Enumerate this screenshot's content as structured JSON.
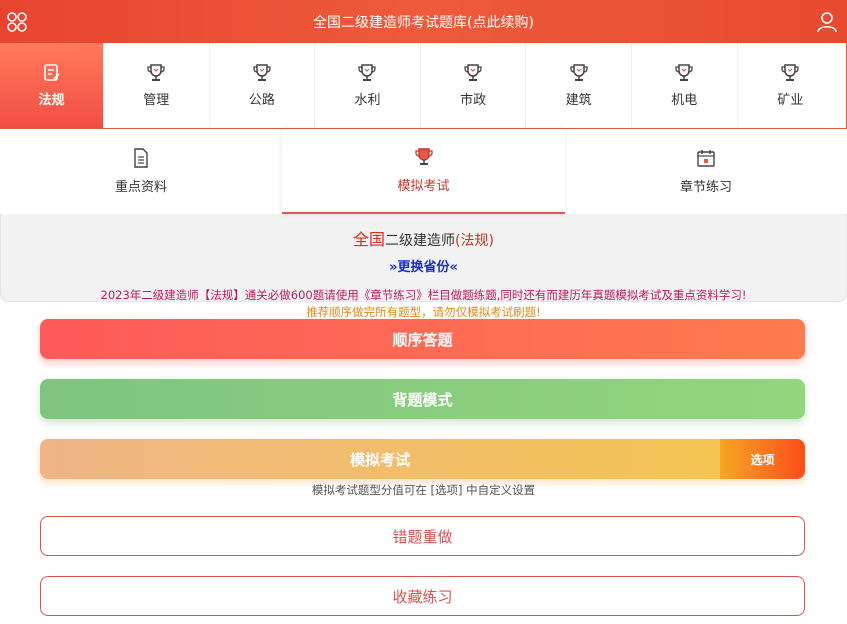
{
  "header": {
    "title": "全国二级建造师考试题库(点此续购)",
    "menu_icon": "grid-menu-icon",
    "user_icon": "user-icon"
  },
  "subjects": [
    {
      "label": "法规",
      "icon": "document-edit-icon",
      "active": true
    },
    {
      "label": "管理",
      "icon": "trophy-icon"
    },
    {
      "label": "公路",
      "icon": "trophy-icon"
    },
    {
      "label": "水利",
      "icon": "trophy-icon"
    },
    {
      "label": "市政",
      "icon": "trophy-icon"
    },
    {
      "label": "建筑",
      "icon": "trophy-icon"
    },
    {
      "label": "机电",
      "icon": "trophy-icon"
    },
    {
      "label": "矿业",
      "icon": "trophy-icon"
    }
  ],
  "tabs": [
    {
      "label": "重点资料",
      "icon": "document-icon"
    },
    {
      "label": "模拟考试",
      "icon": "trophy-icon",
      "active": true
    },
    {
      "label": "章节练习",
      "icon": "calendar-icon"
    }
  ],
  "region": {
    "scope": "全国",
    "exam": "二级建造师",
    "subject": "(法规)",
    "change_link": "»更换省份«"
  },
  "notices": {
    "line1": "2023年二级建造师【法规】通关必做600题请使用《章节练习》栏目做题练题,同时还有而建历年真题模拟考试及重点资料学习!",
    "line2": "推荐顺序做完所有题型，请勿仅模拟考试刷题!"
  },
  "buttons": {
    "order": "顺序答题",
    "memorize": "背题模式",
    "mock": "模拟考试",
    "options": "选项",
    "mock_hint": "模拟考试题型分值可在 [选项] 中自定义设置",
    "wrong_redo": "错题重做",
    "favorites": "收藏练习"
  },
  "colors": {
    "accent": "#e8442f",
    "link": "#1a2dc8",
    "notice_primary": "#c2185b",
    "notice_secondary": "#e08a1a"
  }
}
